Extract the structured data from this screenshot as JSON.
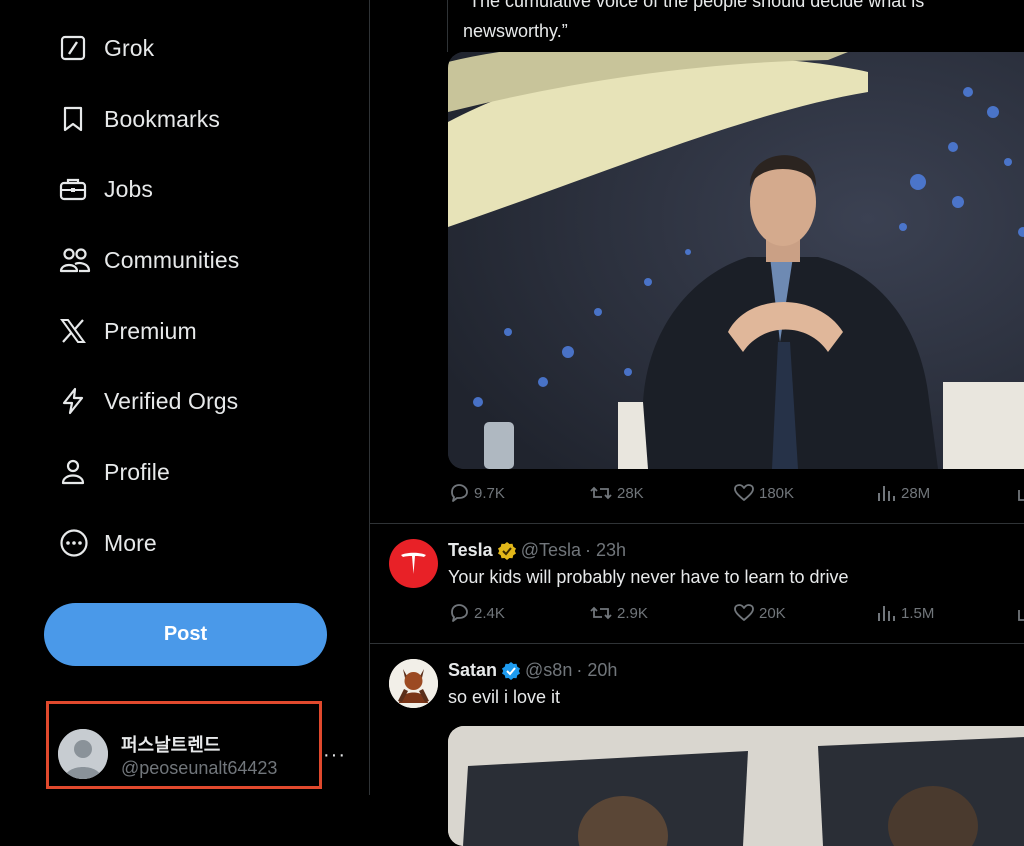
{
  "sidebar": {
    "nav": [
      {
        "label": "Grok",
        "icon": "grok-icon"
      },
      {
        "label": "Bookmarks",
        "icon": "bookmark-icon"
      },
      {
        "label": "Jobs",
        "icon": "briefcase-icon"
      },
      {
        "label": "Communities",
        "icon": "people-icon"
      },
      {
        "label": "Premium",
        "icon": "x-logo-icon"
      },
      {
        "label": "Verified Orgs",
        "icon": "lightning-icon"
      },
      {
        "label": "Profile",
        "icon": "person-icon"
      },
      {
        "label": "More",
        "icon": "more-circle-icon"
      }
    ],
    "post_label": "Post",
    "account": {
      "name": "퍼스날트렌드",
      "handle": "@peoseunalt64423",
      "more": "···"
    }
  },
  "feed": {
    "quoted_post": {
      "text_line1": "“The cumulative voice of the people should decide what is",
      "text_line2": "newsworthy.”",
      "stats": {
        "replies": "9.7K",
        "reposts": "28K",
        "likes": "180K",
        "views": "28M"
      }
    },
    "posts": [
      {
        "name": "Tesla",
        "handle": "@Tesla",
        "time": "· 23h",
        "text": "Your kids will probably never have to learn to drive",
        "verified": "gold",
        "stats": {
          "replies": "2.4K",
          "reposts": "2.9K",
          "likes": "20K",
          "views": "1.5M"
        }
      },
      {
        "name": "Satan",
        "handle": "@s8n",
        "time": "· 20h",
        "text": "so evil i love it",
        "verified": "blue"
      }
    ]
  },
  "colors": {
    "accent": "#4a99e9",
    "highlight_border": "#e0492d",
    "muted": "#71767b",
    "divider": "#2f3336",
    "tesla_red": "#e82127",
    "gold_badge": "#e2b719",
    "blue_badge": "#1d9bf0"
  }
}
